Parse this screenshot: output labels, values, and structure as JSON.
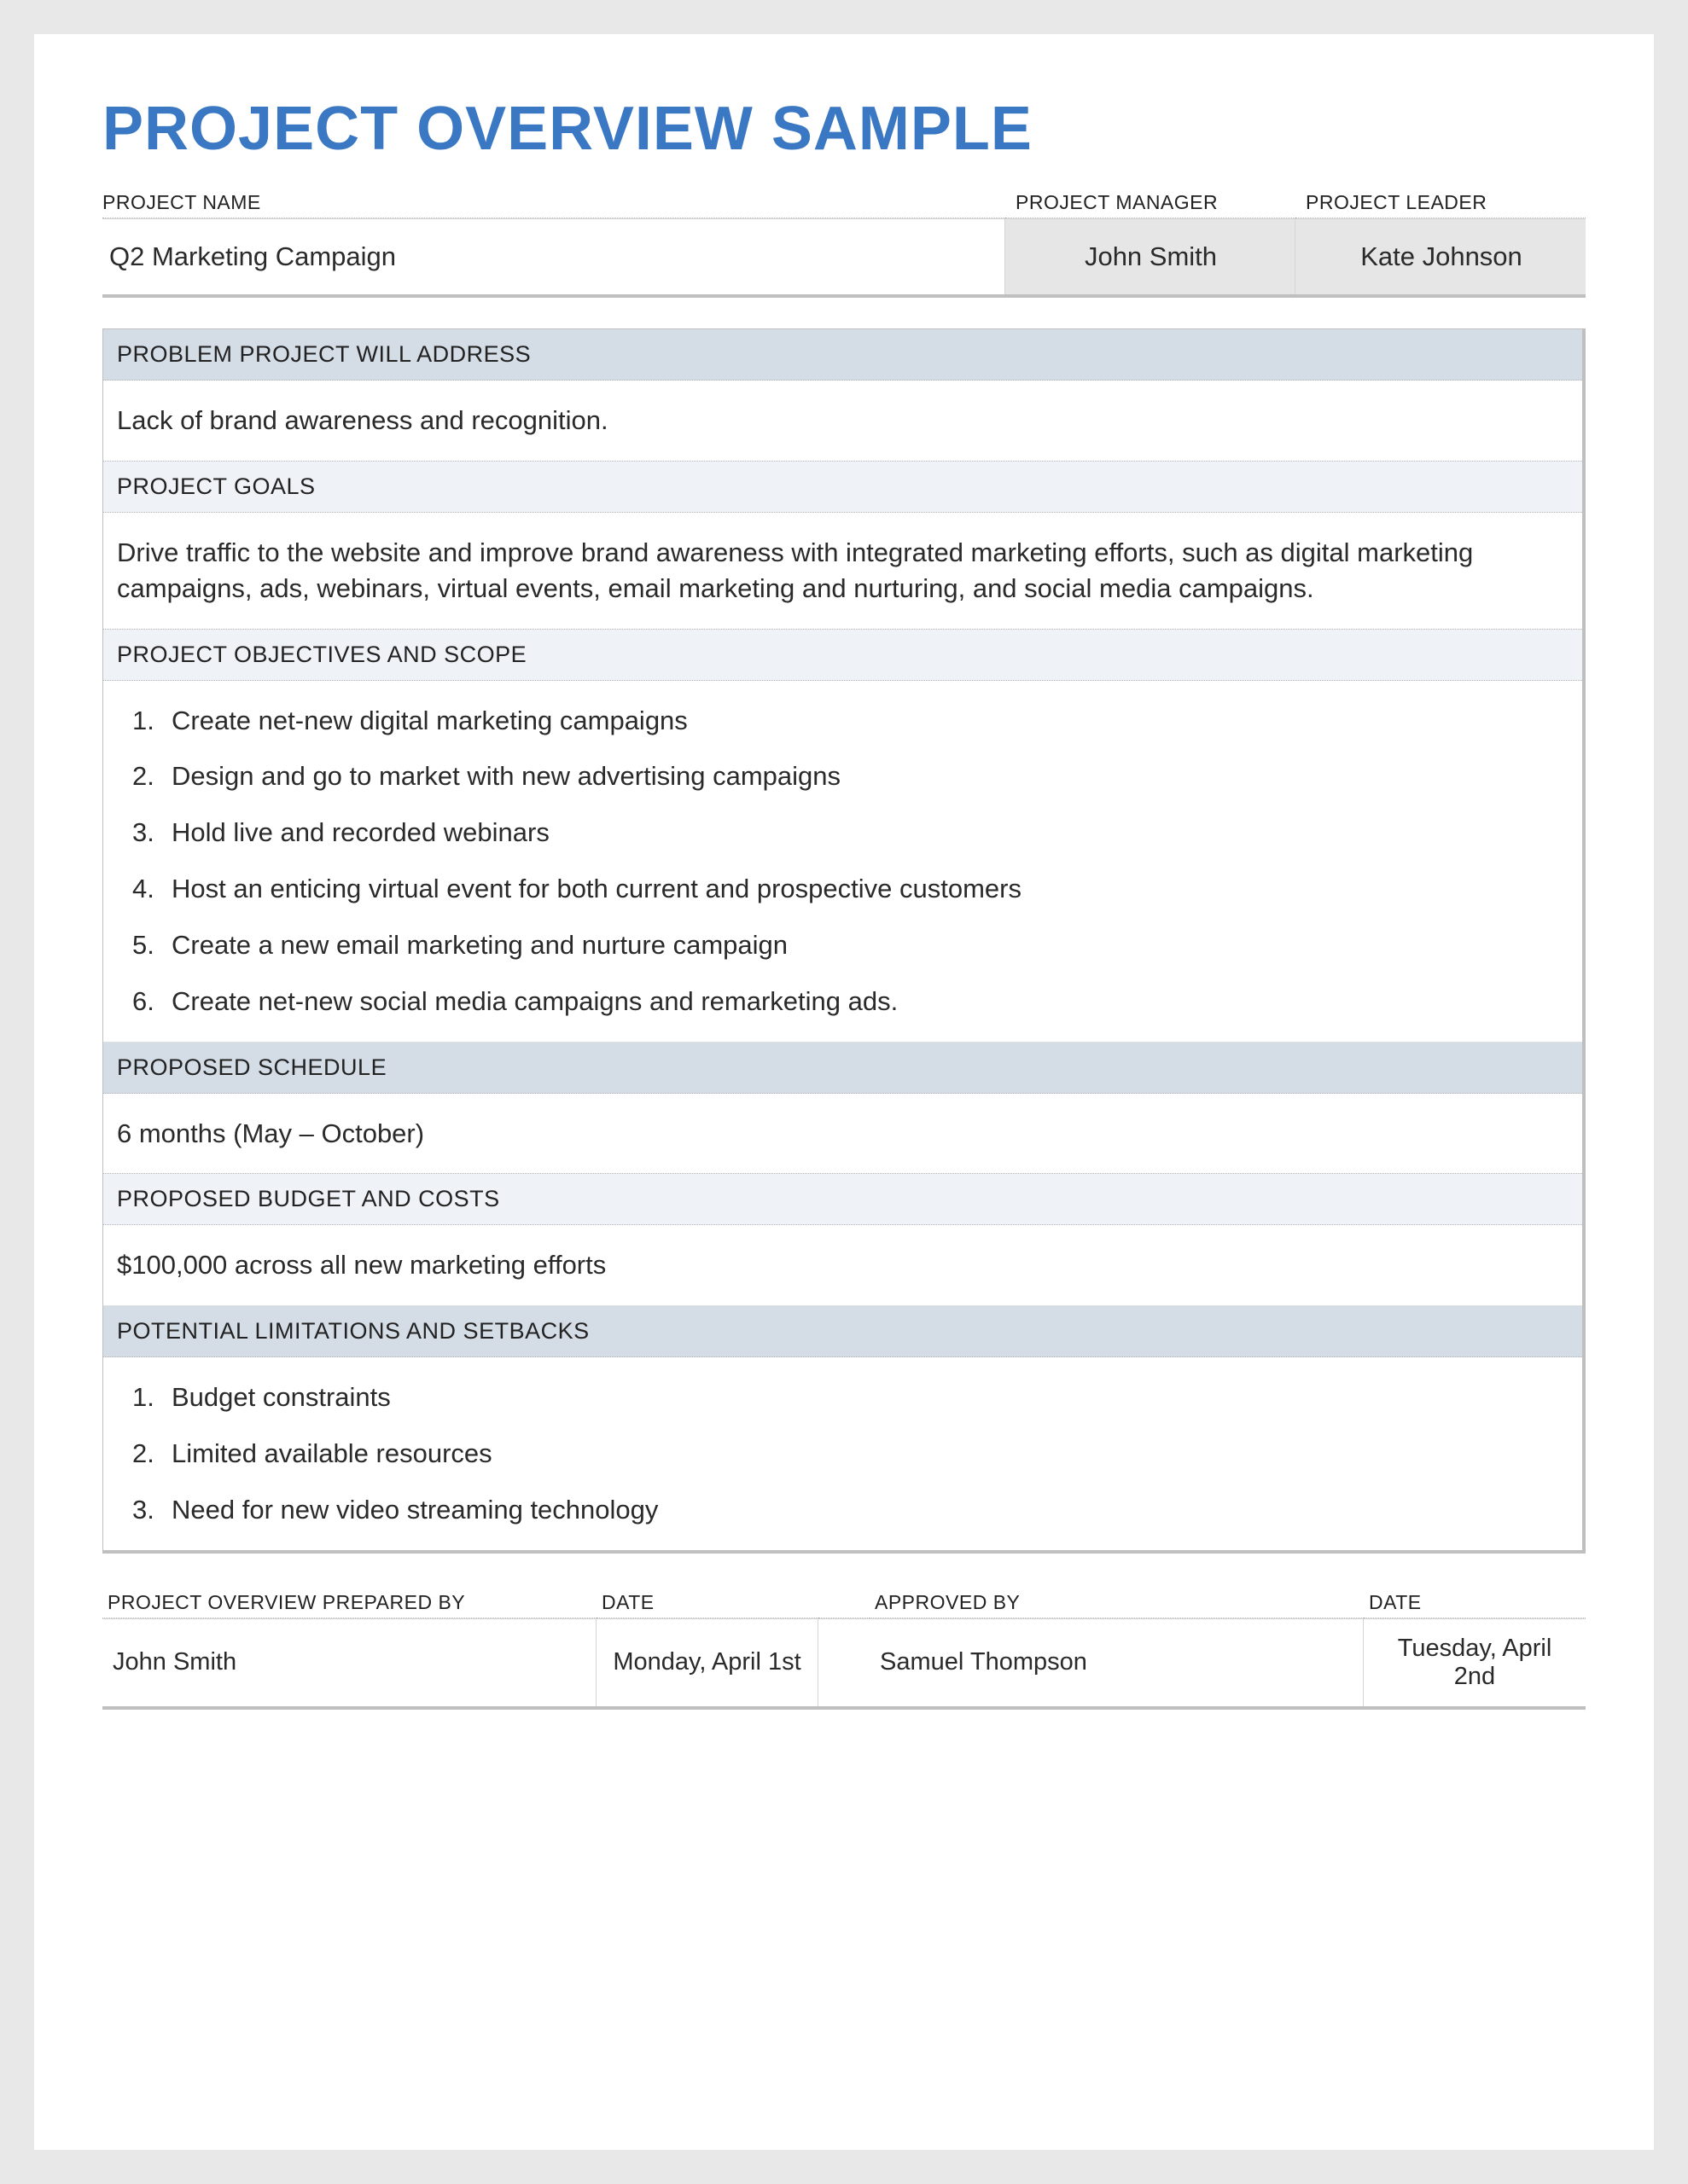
{
  "title": "PROJECT OVERVIEW SAMPLE",
  "header": {
    "labels": {
      "project_name": "PROJECT NAME",
      "project_manager": "PROJECT MANAGER",
      "project_leader": "PROJECT LEADER"
    },
    "values": {
      "project_name": "Q2 Marketing Campaign",
      "project_manager": "John Smith",
      "project_leader": "Kate Johnson"
    }
  },
  "sections": {
    "problem": {
      "label": "PROBLEM PROJECT WILL ADDRESS",
      "body": "Lack of brand awareness and recognition."
    },
    "goals": {
      "label": "PROJECT GOALS",
      "body": "Drive traffic to the website and improve brand awareness with integrated marketing efforts, such as digital marketing campaigns, ads, webinars, virtual events, email marketing and nurturing, and social media campaigns."
    },
    "objectives": {
      "label": "PROJECT OBJECTIVES AND SCOPE",
      "items": [
        "Create net-new digital marketing campaigns",
        "Design and go to market with new advertising campaigns",
        "Hold live and recorded webinars",
        "Host an enticing virtual event for both current and prospective customers",
        "Create a new email marketing and nurture campaign",
        "Create net-new social media campaigns and remarketing ads."
      ]
    },
    "schedule": {
      "label": "PROPOSED SCHEDULE",
      "body": "6 months (May – October)"
    },
    "budget": {
      "label": "PROPOSED BUDGET AND COSTS",
      "body": "$100,000 across all new marketing efforts"
    },
    "limitations": {
      "label": "POTENTIAL LIMITATIONS AND SETBACKS",
      "items": [
        "Budget constraints",
        "Limited available resources",
        "Need for new video streaming technology"
      ]
    }
  },
  "footer": {
    "labels": {
      "prepared_by": "PROJECT OVERVIEW PREPARED BY",
      "prepared_date": "DATE",
      "approved_by": "APPROVED BY",
      "approved_date": "DATE"
    },
    "values": {
      "prepared_by": "John Smith",
      "prepared_date": "Monday, April 1st",
      "approved_by": "Samuel Thompson",
      "approved_date": "Tuesday, April 2nd"
    }
  }
}
